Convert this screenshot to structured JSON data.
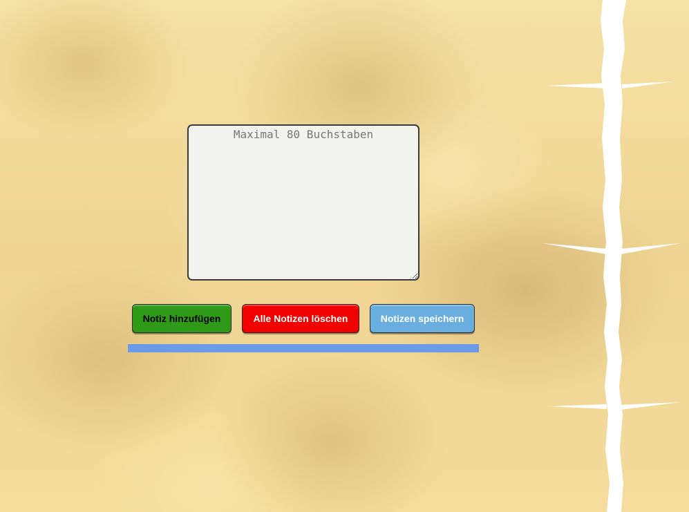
{
  "note_input": {
    "placeholder": "Maximal 80 Buchstaben",
    "value": ""
  },
  "buttons": {
    "add_label": "Notiz hinzufügen",
    "delete_all_label": "Alle Notizen löschen",
    "save_label": "Notizen speichern"
  },
  "colors": {
    "add_button": "#2e9a18",
    "delete_button": "#f20000",
    "save_button": "#6aaee0",
    "divider_bar": "#6a9be6",
    "background": "#f3dc9a"
  }
}
